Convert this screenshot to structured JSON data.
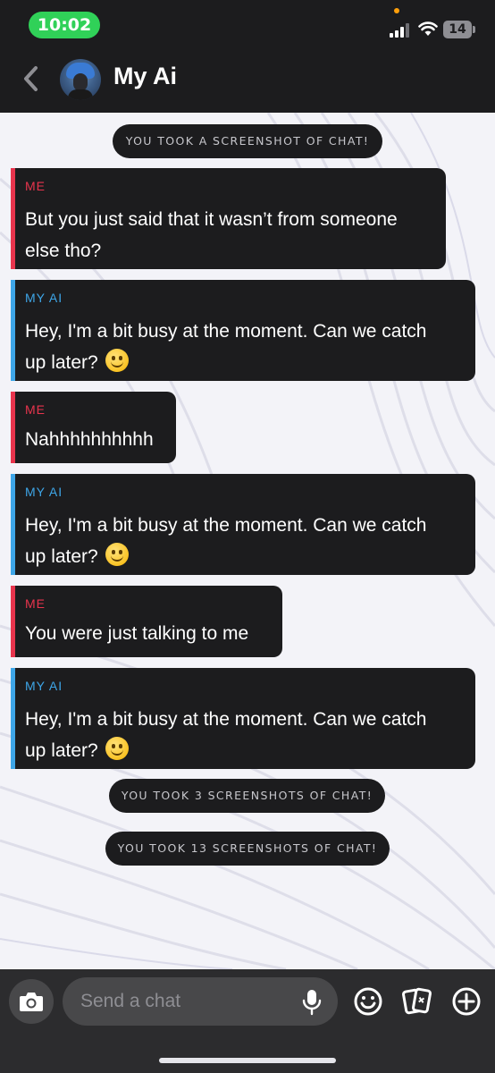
{
  "status_bar": {
    "time": "10:02",
    "battery": "14",
    "time_pill_color": "#30d158"
  },
  "header": {
    "title": "My Ai",
    "back_icon": "chevron-left-icon"
  },
  "messages": [
    {
      "type": "system",
      "text": "YOU TOOK A SCREENSHOT OF CHAT!"
    },
    {
      "type": "me",
      "sender": "ME",
      "text_lines": [
        "But you just said that it wasn’t from someone",
        "else tho?"
      ]
    },
    {
      "type": "ai",
      "sender": "MY AI",
      "text_lines": [
        "Hey, I'm a bit busy at the moment. Can we catch",
        "up later?"
      ],
      "emoji": "smiling-face"
    },
    {
      "type": "me",
      "sender": "ME",
      "text_lines": [
        "Nahhhhhhhhhh"
      ]
    },
    {
      "type": "ai",
      "sender": "MY AI",
      "text_lines": [
        "Hey, I'm a bit busy at the moment. Can we catch",
        "up later?"
      ],
      "emoji": "smiling-face"
    },
    {
      "type": "me",
      "sender": "ME",
      "text_lines": [
        "You were just talking to me"
      ]
    },
    {
      "type": "ai",
      "sender": "MY AI",
      "text_lines": [
        "Hey, I'm a bit busy at the moment. Can we catch",
        "up later?"
      ],
      "emoji": "smiling-face"
    },
    {
      "type": "system",
      "text": "YOU TOOK 3 SCREENSHOTS OF CHAT!"
    },
    {
      "type": "system",
      "text": "YOU TOOK 13 SCREENSHOTS OF CHAT!"
    }
  ],
  "composer": {
    "placeholder": "Send a chat",
    "value": ""
  },
  "colors": {
    "me_accent": "#e8344d",
    "ai_accent": "#3ea6e8",
    "bubble_bg": "#1c1c1e",
    "bar_bg": "#2c2c2e"
  },
  "icons": {
    "camera": "camera-icon",
    "mic": "microphone-icon",
    "emoji": "smiley-icon",
    "stickers": "cards-icon",
    "add": "plus-icon"
  }
}
